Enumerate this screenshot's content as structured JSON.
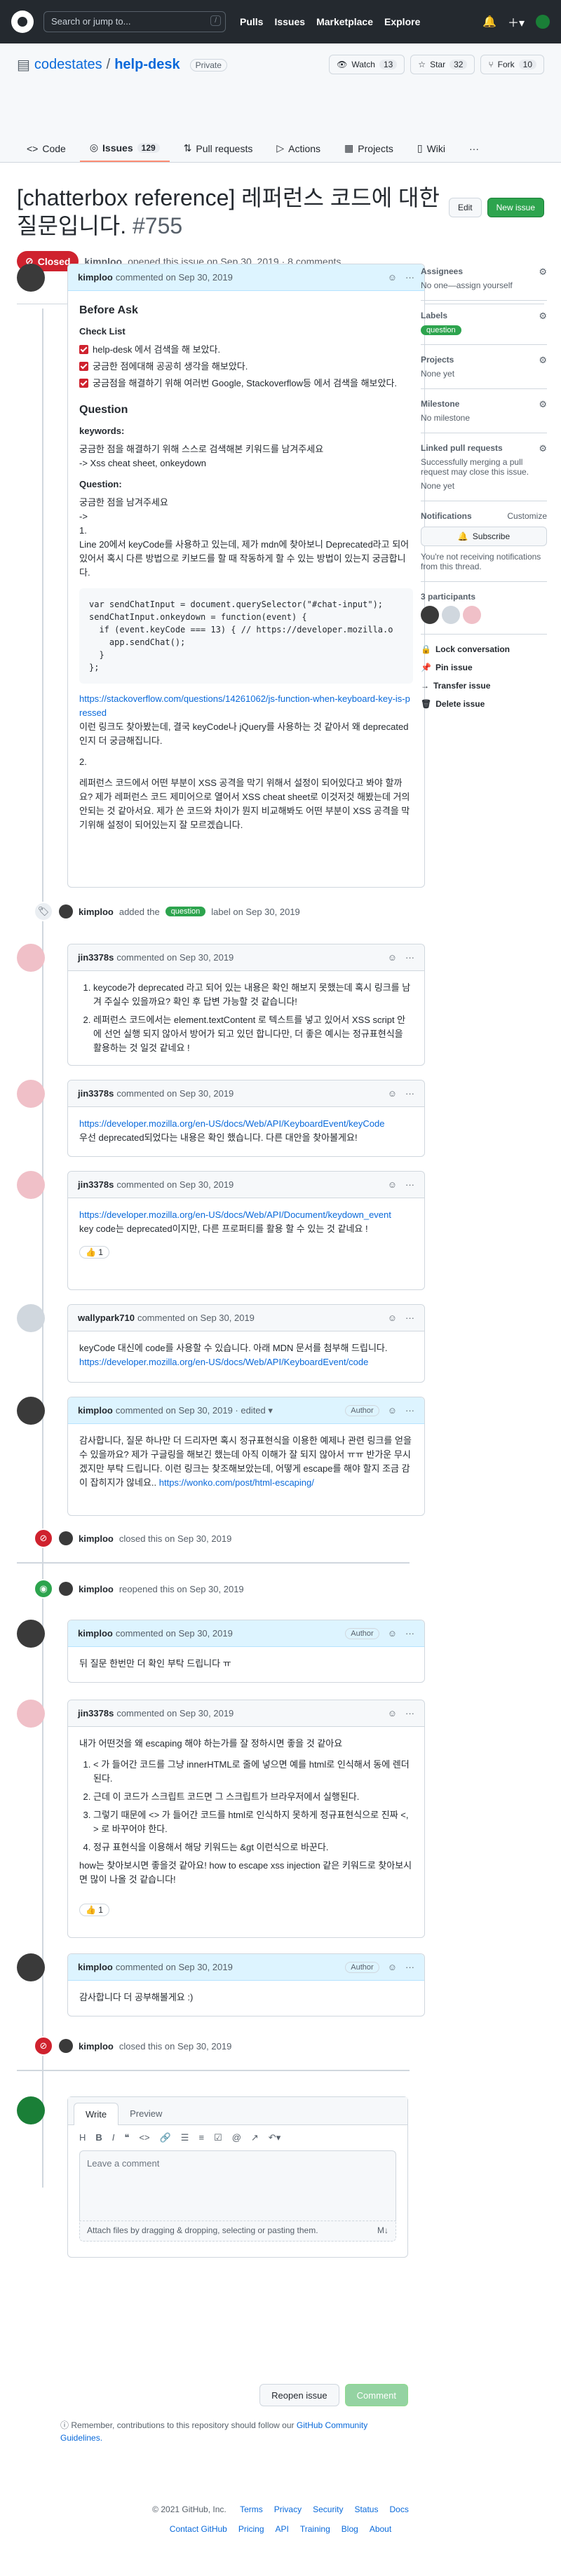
{
  "header": {
    "search_placeholder": "Search or jump to...",
    "search_key": "/",
    "nav": [
      "Pulls",
      "Issues",
      "Marketplace",
      "Explore"
    ]
  },
  "repo": {
    "owner": "codestates",
    "name": "help-desk",
    "visibility": "Private",
    "watch_label": "Watch",
    "watch_count": "13",
    "star_label": "Star",
    "star_count": "32",
    "fork_label": "Fork",
    "fork_count": "10",
    "tabs": [
      {
        "label": "Code"
      },
      {
        "label": "Issues",
        "count": "129"
      },
      {
        "label": "Pull requests"
      },
      {
        "label": "Actions"
      },
      {
        "label": "Projects"
      },
      {
        "label": "Wiki"
      }
    ]
  },
  "issue": {
    "title": "[chatterbox reference] 레퍼런스 코드에 대한 질문입니다.",
    "number": "#755",
    "edit_label": "Edit",
    "new_issue_label": "New issue",
    "state": "Closed",
    "author": "kimploo",
    "meta": "opened this issue on Sep 30, 2019 · 8 comments"
  },
  "comments": {
    "c1": {
      "author": "kimploo",
      "meta": "commented on Sep 30, 2019",
      "h_before": "Before Ask",
      "h_check": "Check List",
      "checks": [
        "help-desk 에서 검색을 해 보았다.",
        "궁금한 점에대해 공공히 생각을 해보았다.",
        "궁금점을 해결하기 위해 여러번 Google, Stackoverflow등 에서 검색을 해보았다."
      ],
      "h_question": "Question",
      "kw_title": "keywords:",
      "kw_1": "궁금한 점을 해결하기 위해 스스로 검색해본 키워드를 남겨주세요",
      "kw_2": "-> Xss cheat sheet, onkeydown",
      "q_title": "Question:",
      "q_1": "궁금한 점을 남겨주세요",
      "q_2": "->",
      "q_3": "1.",
      "q_4": "Line 20에서 keyCode를 사용하고 있는데, 제가 mdn에 찾아보니 Deprecated라고 되어있어서 혹시 다른 방법으로 키보드를 할 때 작동하게 할 수 있는 방법이 있는지 궁금합니다.",
      "code": [
        {
          "t": "var sendChatInput = document.querySelector(\"#chat-input\");"
        },
        {
          "t": "sendChatInput.onkeydown = function(event) {"
        },
        {
          "t": "  if (event.keyCode === 13) { // https://developer.mozilla.o"
        },
        {
          "t": "    app.sendChat();"
        },
        {
          "t": "  }"
        },
        {
          "t": "};"
        }
      ],
      "link": "https://stackoverflow.com/questions/14261062/js-function-when-keyboard-key-is-pressed",
      "link_note": "이런 링크도 찾아봤는데, 결국 keyCode나 jQuery를 사용하는 것 같아서 왜 deprecated인지 더 궁금해집니다.",
      "q_5": "2.",
      "q_6": "레퍼런스 코드에서 어떤 부분이 XSS 공격을 막기 위해서 설정이 되어있다고 봐야 할까요? 제가 레퍼런스 코드 제미어으로 열어서 XSS cheat sheet로 이것저것 해봤는데 거의 안되는 것 같아서요. 제가 쓴 코드와 차이가 뭔지 비교해봐도 어떤 부분이 XSS 공격을 막기위해 설정이 되어있는지 잘 모르겠습니다."
    },
    "event_label": {
      "author": "kimploo",
      "pre": "added the",
      "label": "question",
      "post": "label on Sep 30, 2019"
    },
    "c2": {
      "author": "jin3378s",
      "meta": "commented on Sep 30, 2019",
      "items": [
        "keycode가 deprecated 라고 되어 있는 내용은 확인 해보지 못했는데 혹시 링크를 남겨 주실수 있을까요? 확인 후 답변 가능할 것 같습니다!",
        "레퍼런스 코드에서는 element.textContent 로 텍스트를 넣고 있어서 XSS script 안에 선언 실행 되지 않아서 방어가 되고 있던 합니다만, 더 좋은 예시는 정규표현식을 활용하는 것 일것 같네요 !"
      ]
    },
    "c3": {
      "author": "jin3378s",
      "meta": "commented on Sep 30, 2019",
      "link": "https://developer.mozilla.org/en-US/docs/Web/API/KeyboardEvent/keyCode",
      "note": "우선 deprecated되었다는 내용은 확인 했습니다. 다른 대안을 찾아볼게요!"
    },
    "c4": {
      "author": "jin3378s",
      "meta": "commented on Sep 30, 2019",
      "link": "https://developer.mozilla.org/en-US/docs/Web/API/Document/keydown_event",
      "note": "key code는 deprecated이지만, 다른 프로퍼티를 활용 할 수 있는 것 같네요 !",
      "reaction": "👍 1"
    },
    "c5": {
      "author": "wallypark710",
      "meta": "commented on Sep 30, 2019",
      "note": "keyCode 대신에 code를 사용할 수 있습니다. 아래 MDN 문서를 첨부해 드립니다.",
      "link": "https://developer.mozilla.org/en-US/docs/Web/API/KeyboardEvent/code"
    },
    "c6": {
      "author": "kimploo",
      "meta": "commented on Sep 30, 2019 · edited ▾",
      "role": "Author",
      "note": "감사합니다, 질문 하나만 더 드리자면 혹시 정규표현식을 이용한 예제나 관련 링크를 얻을 수 있을까요? 제가 구글링을 해보긴 했는데 아직 이해가 잘 되지 않아서 ㅠㅠ 반가운 무시겠지만 부탁 드립니다. 이런 링크는 찾조해보았는데, 어떻게 escape를 해야 할지 조금 감이 잡히지가 않네요..",
      "link": "https://wonko.com/post/html-escaping/"
    },
    "ev_closed1": {
      "author": "kimploo",
      "text": "closed this on Sep 30, 2019"
    },
    "ev_reopened": {
      "author": "kimploo",
      "text": "reopened this on Sep 30, 2019"
    },
    "c7": {
      "author": "kimploo",
      "meta": "commented on Sep 30, 2019",
      "role": "Author",
      "note": "뒤 질문 한번만 더 확인 부탁 드립니다 ㅠ"
    },
    "c8": {
      "author": "jin3378s",
      "meta": "commented on Sep 30, 2019",
      "intro": "내가 어떤것을 왜 escaping 해야 하는가를 잘 정하시면 좋을 것 같아요",
      "items": [
        "< 가 들어간 코드를 그냥 innerHTML로 줄에 넣으면 예를 html로 인식해서 동에 렌더 된다.",
        "근데 이 코드가 스크립트 코드면 그 스크립트가 브라우저에서 실행된다.",
        "그렇기 때문에 <> 가 들어간 코드를 html로 인식하지 못하게 정규표현식으로 진짜 <, > 로 바꾸어야 한다.",
        "정규 표현식을 이용해서 해당 키워드는 &gt 이런식으로 바꾼다."
      ],
      "outro": "how는 찾아보시면 좋을것 같아요! how to escape xss injection 같은 키워드로 찾아보시면 많이 나올 것 같습니다!",
      "reaction": "👍 1"
    },
    "c9": {
      "author": "kimploo",
      "meta": "commented on Sep 30, 2019",
      "role": "Author",
      "note": "감사합니다 더 공부해볼게요 :)"
    },
    "ev_closed2": {
      "author": "kimploo",
      "text": "closed this on Sep 30, 2019"
    }
  },
  "sidebar": {
    "assignees_title": "Assignees",
    "assignees_value": "No one—assign yourself",
    "labels_title": "Labels",
    "label": "question",
    "projects_title": "Projects",
    "projects_value": "None yet",
    "milestone_title": "Milestone",
    "milestone_value": "No milestone",
    "linked_title": "Linked pull requests",
    "linked_value": "Successfully merging a pull request may close this issue.",
    "linked_none": "None yet",
    "notif_title": "Notifications",
    "customize": "Customize",
    "subscribe": "Subscribe",
    "notif_note": "You're not receiving notifications from this thread.",
    "participants": "3 participants",
    "lock": "Lock conversation",
    "pin": "Pin issue",
    "transfer": "Transfer issue",
    "delete": "Delete issue"
  },
  "composer": {
    "tab_write": "Write",
    "tab_preview": "Preview",
    "placeholder": "Leave a comment",
    "attach": "Attach files by dragging & dropping, selecting or pasting them.",
    "reopen": "Reopen issue",
    "comment": "Comment",
    "remember_pre": "Remember, contributions to this repository should follow our",
    "remember_link": "GitHub Community Guidelines."
  },
  "footer": {
    "copyright": "© 2021 GitHub, Inc.",
    "links1": [
      "Terms",
      "Privacy",
      "Security",
      "Status",
      "Docs"
    ],
    "links2": [
      "Contact GitHub",
      "Pricing",
      "API",
      "Training",
      "Blog",
      "About"
    ]
  },
  "colors": {
    "closed": "#cf222e",
    "open": "#2da44e",
    "link": "#0969da",
    "header": "#24292f"
  }
}
